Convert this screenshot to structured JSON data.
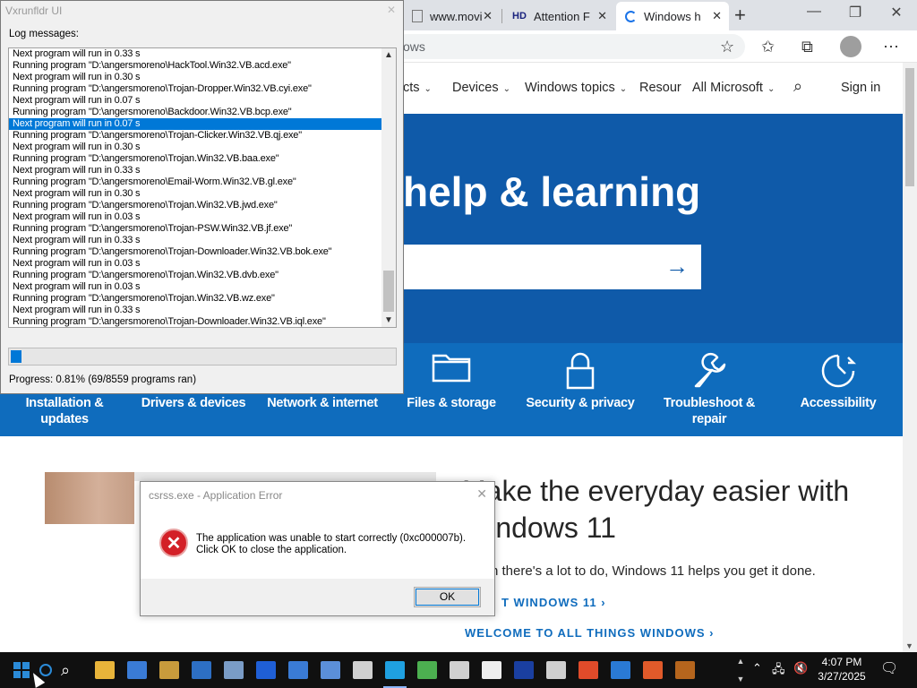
{
  "browser": {
    "tabs": [
      {
        "label": "www.movi",
        "icon": "page-icon"
      },
      {
        "label": "Attention F",
        "icon": "hd-icon",
        "icon_text": "HD"
      },
      {
        "label": "Windows h",
        "icon": "loading-icon"
      }
    ],
    "url_text": "ows",
    "nav": {
      "items": [
        "cts",
        "Devices",
        "Windows topics",
        "Resour",
        "All Microsoft"
      ],
      "signin": "Sign in"
    },
    "hero": {
      "title": "help & learning"
    },
    "categories": [
      {
        "label": "Installation & updates",
        "icon": "download-icon",
        "glyph": ""
      },
      {
        "label": "Drivers & devices",
        "icon": "devices-icon",
        "glyph": ""
      },
      {
        "label": "Network & internet",
        "icon": "network-icon",
        "glyph": ""
      },
      {
        "label": "Files & storage",
        "icon": "folder-icon",
        "glyph": "🗀"
      },
      {
        "label": "Security & privacy",
        "icon": "lock-icon",
        "glyph": "🔒"
      },
      {
        "label": "Troubleshoot & repair",
        "icon": "wrench-icon",
        "glyph": "🔧"
      },
      {
        "label": "Accessibility",
        "icon": "accessibility-icon",
        "glyph": "⟳"
      }
    ],
    "promo": {
      "title": "Make the everyday easier with Windows 11",
      "subtitle": "n there's a lot to do, Windows 11 helps you get it done.",
      "link1": "T WINDOWS 11",
      "link2": "WELCOME TO ALL THINGS WINDOWS"
    }
  },
  "vx": {
    "title": "Vxrunfldr UI",
    "log_label": "Log messages:",
    "log": [
      "Next program will run in 0.33 s",
      "Running program \"D:\\angersmoreno\\HackTool.Win32.VB.acd.exe\"",
      "Next program will run in 0.30 s",
      "Running program \"D:\\angersmoreno\\Trojan-Dropper.Win32.VB.cyi.exe\"",
      "Next program will run in 0.07 s",
      "Running program \"D:\\angersmoreno\\Backdoor.Win32.VB.bcp.exe\"",
      "Next program will run in 0.07 s",
      "Running program \"D:\\angersmoreno\\Trojan-Clicker.Win32.VB.qj.exe\"",
      "Next program will run in 0.30 s",
      "Running program \"D:\\angersmoreno\\Trojan.Win32.VB.baa.exe\"",
      "Next program will run in 0.33 s",
      "Running program \"D:\\angersmoreno\\Email-Worm.Win32.VB.gl.exe\"",
      "Next program will run in 0.30 s",
      "Running program \"D:\\angersmoreno\\Trojan.Win32.VB.jwd.exe\"",
      "Next program will run in 0.03 s",
      "Running program \"D:\\angersmoreno\\Trojan-PSW.Win32.VB.jf.exe\"",
      "Next program will run in 0.33 s",
      "Running program \"D:\\angersmoreno\\Trojan-Downloader.Win32.VB.bok.exe\"",
      "Next program will run in 0.03 s",
      "Running program \"D:\\angersmoreno\\Trojan.Win32.VB.dvb.exe\"",
      "Next program will run in 0.03 s",
      "Running program \"D:\\angersmoreno\\Trojan.Win32.VB.wz.exe\"",
      "Next program will run in 0.33 s",
      "Running program \"D:\\angersmoreno\\Trojan-Downloader.Win32.VB.iql.exe\""
    ],
    "selected_index": 6,
    "progress_fraction": 0.0081,
    "progress_text": "Progress: 0.81% (69/8559 programs ran)"
  },
  "error": {
    "title": "csrss.exe - Application Error",
    "line1": "The application was unable to start correctly (0xc000007b).",
    "line2": "Click OK to close the application.",
    "ok": "OK"
  },
  "taskbar": {
    "time": "4:07 PM",
    "date": "3/27/2025",
    "apps": [
      {
        "name": "file-explorer-icon",
        "color": "#e8b43a"
      },
      {
        "name": "app-window-icon",
        "color": "#3a7bd5"
      },
      {
        "name": "money-bag-icon",
        "color": "#c89b3c"
      },
      {
        "name": "window-icon",
        "color": "#2d6fc4"
      },
      {
        "name": "tools-icon",
        "color": "#7a9cc6"
      },
      {
        "name": "heart-icon",
        "color": "#1f5fd6"
      },
      {
        "name": "dialog-icon",
        "color": "#3a7bd5"
      },
      {
        "name": "window2-icon",
        "color": "#5b8fd9"
      },
      {
        "name": "folder2-icon",
        "color": "#d0d0d0"
      },
      {
        "name": "edge-icon",
        "color": "#1fa0e0"
      },
      {
        "name": "monitor-icon",
        "color": "#4caf50"
      },
      {
        "name": "folder3-icon",
        "color": "#d0d0d0"
      },
      {
        "name": "bulb-icon",
        "color": "#eeeeee"
      },
      {
        "name": "chart-icon",
        "color": "#1a3fa0"
      },
      {
        "name": "folder4-icon",
        "color": "#cfcfcf"
      },
      {
        "name": "windows-flag-icon",
        "color": "#e04b2a"
      },
      {
        "name": "ie-icon",
        "color": "#2a7ad5"
      },
      {
        "name": "swirl-icon",
        "color": "#e05a2a"
      },
      {
        "name": "toolbox-icon",
        "color": "#b5651d"
      }
    ]
  }
}
